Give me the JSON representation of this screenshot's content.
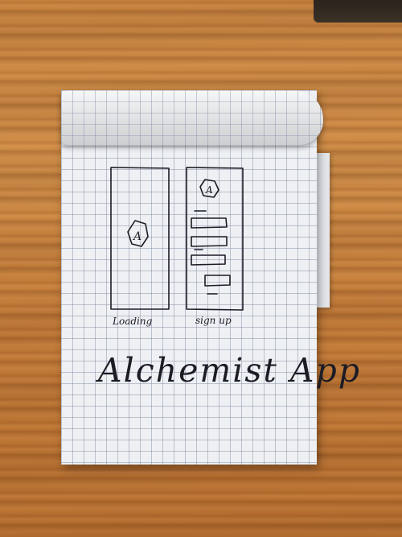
{
  "scene": {
    "surface": "wooden-table",
    "object": "grid-notepad",
    "colors": {
      "wood": "#c9843f",
      "paper": "#eef0f3",
      "ink": "#1c1c24"
    }
  },
  "sketch": {
    "screens": [
      {
        "caption": "Loading",
        "logo_letter": "A"
      },
      {
        "caption": "sign up",
        "logo_letter": "A",
        "field_count": 4
      }
    ],
    "title": "Alchemist App"
  }
}
